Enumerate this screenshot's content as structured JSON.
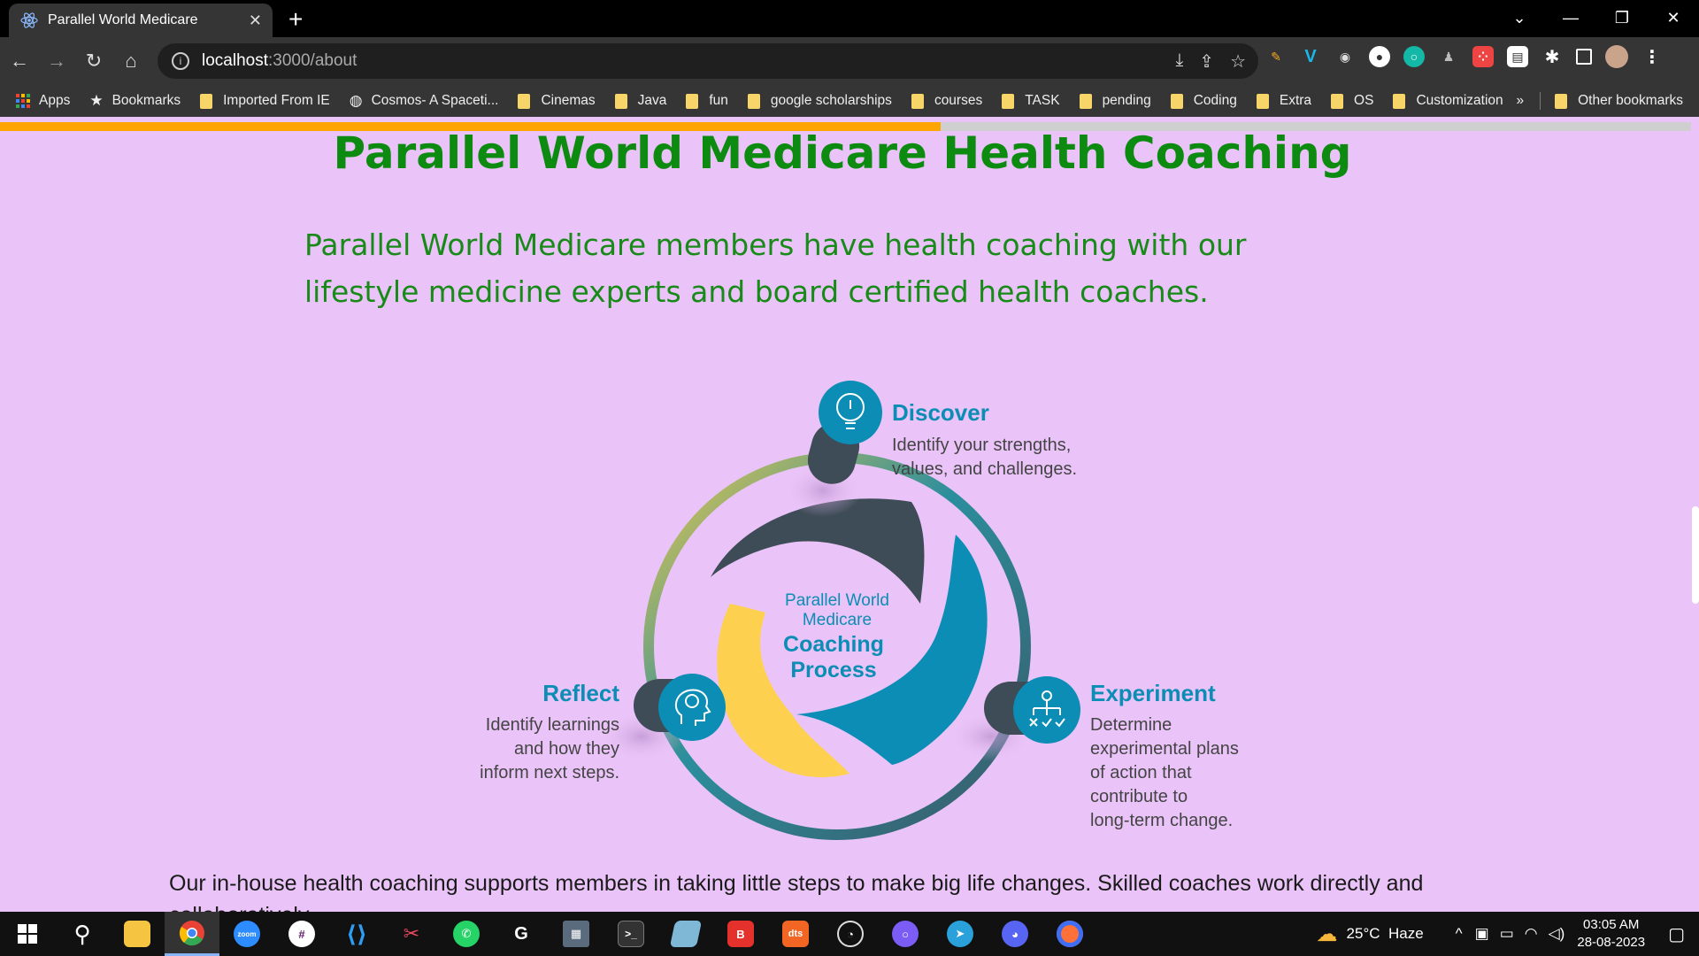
{
  "browser": {
    "tab_title": "Parallel World Medicare",
    "url_host": "localhost",
    "url_path": ":3000/about",
    "bookmarks": [
      {
        "label": "Apps",
        "icon": "apps-grid-icon"
      },
      {
        "label": "Bookmarks",
        "icon": "star-icon"
      },
      {
        "label": "Imported From IE",
        "icon": "folder-icon"
      },
      {
        "label": "Cosmos- A Spaceti...",
        "icon": "globe-icon"
      },
      {
        "label": "Cinemas",
        "icon": "folder-icon"
      },
      {
        "label": "Java",
        "icon": "folder-icon"
      },
      {
        "label": "fun",
        "icon": "folder-icon"
      },
      {
        "label": "google scholarships",
        "icon": "folder-icon"
      },
      {
        "label": "courses",
        "icon": "folder-icon"
      },
      {
        "label": "TASK",
        "icon": "folder-icon"
      },
      {
        "label": "pending",
        "icon": "folder-icon"
      },
      {
        "label": "Coding",
        "icon": "folder-icon"
      },
      {
        "label": "Extra",
        "icon": "folder-icon"
      },
      {
        "label": "OS",
        "icon": "folder-icon"
      },
      {
        "label": "Customization",
        "icon": "folder-icon"
      }
    ],
    "bookmarks_overflow": "»",
    "other_bookmarks": "Other bookmarks"
  },
  "page": {
    "scroll_progress_percent": 55.6,
    "heading": "Parallel World Medicare Health Coaching",
    "intro": "Parallel World Medicare members have health coaching with our lifestyle medicine experts and board certified health coaches.",
    "diagram": {
      "center_line1": "Parallel World",
      "center_line2": "Medicare",
      "center_line3": "Coaching",
      "center_line4": "Process",
      "discover_title": "Discover",
      "discover_line1": "Identify your strengths,",
      "discover_line2": "values, and challenges.",
      "reflect_title": "Reflect",
      "reflect_line1": "Identify learnings",
      "reflect_line2": "and how they",
      "reflect_line3": "inform next steps.",
      "experiment_title": "Experiment",
      "experiment_line1": "Determine",
      "experiment_line2": "experimental plans",
      "experiment_line3": "of action that",
      "experiment_line4": "contribute to",
      "experiment_line5": "long-term change."
    },
    "body": "Our in-house health coaching supports members in taking little steps to make big life changes. Skilled coaches work directly and collaboratively"
  },
  "taskbar": {
    "weather": "25°C  Haze",
    "time": "03:05 AM",
    "date": "28-08-2023"
  },
  "colors": {
    "page_bg": "#eac4f8",
    "heading": "#0d8a10",
    "progress": "#ffa500",
    "diagram_teal": "#0b8db5",
    "diagram_dark": "#3e4c57",
    "diagram_yellow": "#fdd050"
  }
}
